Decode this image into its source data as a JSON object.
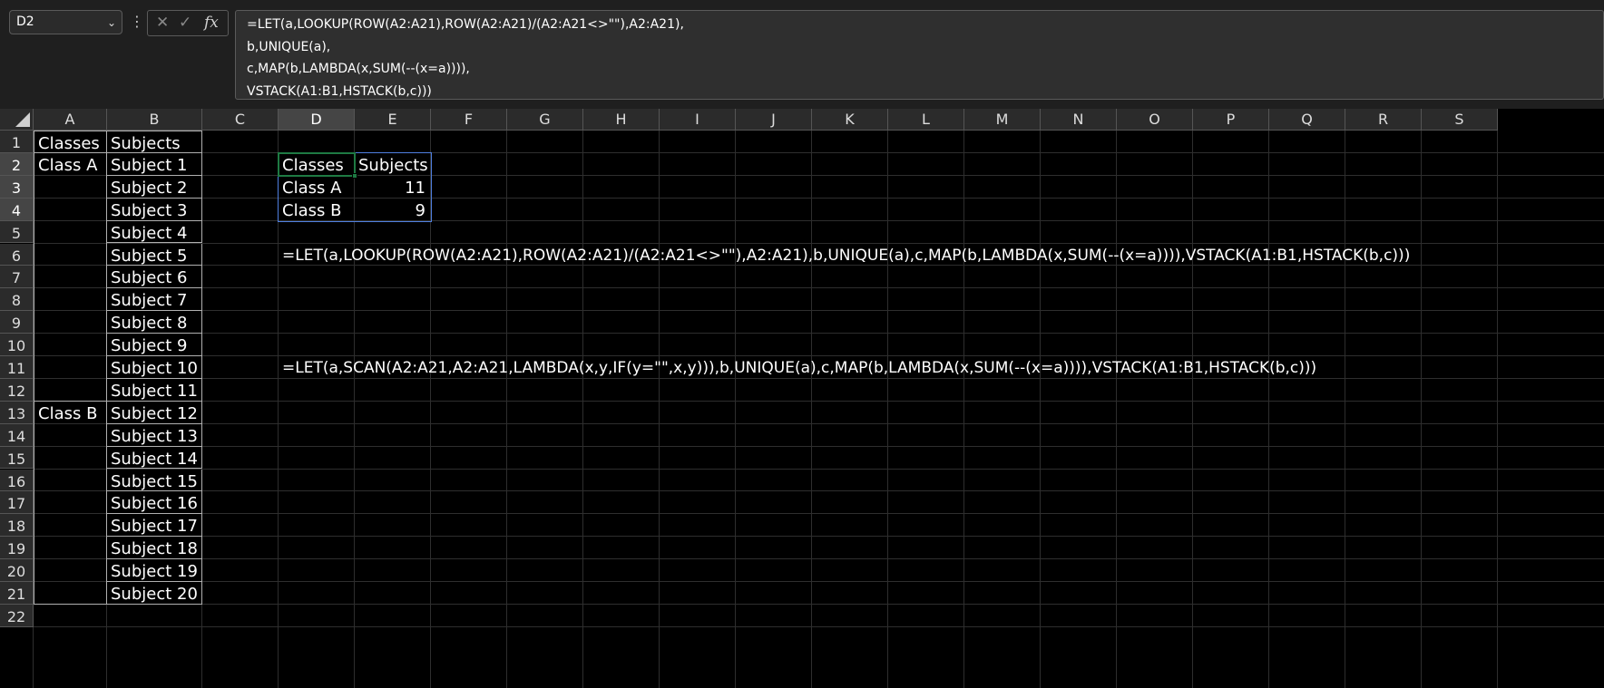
{
  "name_box": {
    "value": "D2"
  },
  "formula_bar": {
    "lines": [
      "=LET(a,LOOKUP(ROW(A2:A21),ROW(A2:A21)/(A2:A21<>\"\"),A2:A21),",
      "b,UNIQUE(a),",
      "c,MAP(b,LAMBDA(x,SUM(--(x=a)))),",
      "VSTACK(A1:B1,HSTACK(b,c)))"
    ],
    "cancel_glyph": "✕",
    "enter_glyph": "✓",
    "fx_label": "fx"
  },
  "columns": [
    "A",
    "B",
    "C",
    "D",
    "E",
    "F",
    "G",
    "H",
    "I",
    "J",
    "K",
    "L",
    "M",
    "N",
    "O",
    "P",
    "Q",
    "R",
    "S"
  ],
  "rows": [
    "1",
    "2",
    "3",
    "4",
    "5",
    "6",
    "7",
    "8",
    "9",
    "10",
    "11",
    "12",
    "13",
    "14",
    "15",
    "16",
    "17",
    "18",
    "19",
    "20",
    "21",
    "22"
  ],
  "sheet": {
    "A1": "Classes",
    "B1": "Subjects",
    "A2": "Class A",
    "A13": "Class B",
    "subjects": [
      "Subject 1",
      "Subject 2",
      "Subject 3",
      "Subject 4",
      "Subject 5",
      "Subject 6",
      "Subject 7",
      "Subject 8",
      "Subject 9",
      "Subject 10",
      "Subject 11",
      "Subject 12",
      "Subject 13",
      "Subject 14",
      "Subject 15",
      "Subject 16",
      "Subject 17",
      "Subject 18",
      "Subject 19",
      "Subject 20"
    ],
    "D2": "Classes",
    "E2": "Subjects",
    "D3": "Class A",
    "E3": "11",
    "D4": "Class B",
    "E4": "9",
    "D6": "=LET(a,LOOKUP(ROW(A2:A21),ROW(A2:A21)/(A2:A21<>\"\"),A2:A21),b,UNIQUE(a),c,MAP(b,LAMBDA(x,SUM(--(x=a)))),VSTACK(A1:B1,HSTACK(b,c)))",
    "D11": "=LET(a,SCAN(A2:A21,A2:A21,LAMBDA(x,y,IF(y=\"\",x,y))),b,UNIQUE(a),c,MAP(b,LAMBDA(x,SUM(--(x=a)))),VSTACK(A1:B1,HSTACK(b,c)))"
  },
  "colors": {
    "selection_border": "#4f7fe0",
    "active_cell_border": "#1e7a43",
    "background": "#000000"
  }
}
